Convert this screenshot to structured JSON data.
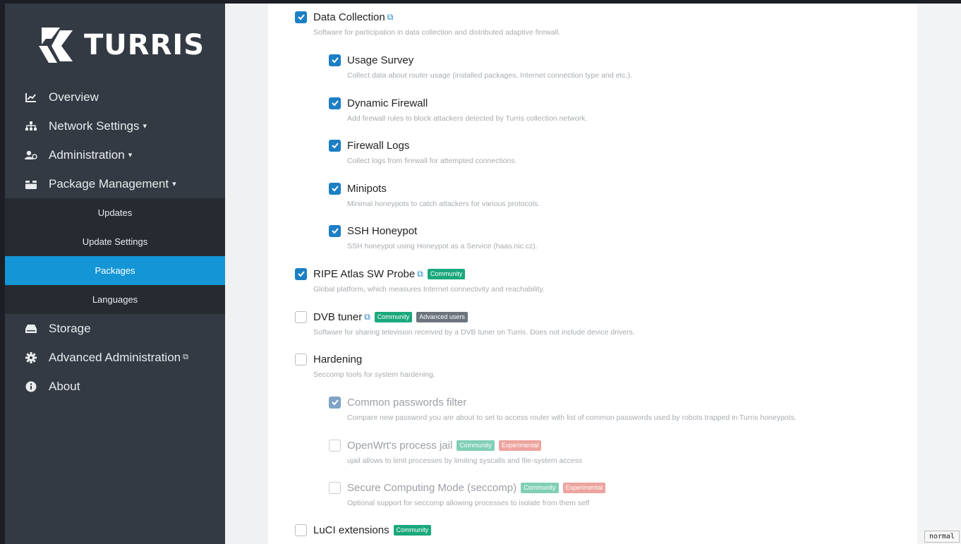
{
  "brand": {
    "name": "TURRIS"
  },
  "sidebar": {
    "items": [
      {
        "label": "Overview",
        "icon": "chart-icon"
      },
      {
        "label": "Network Settings",
        "icon": "network-icon",
        "dropdown": true
      },
      {
        "label": "Administration",
        "icon": "users-icon",
        "dropdown": true
      },
      {
        "label": "Package Management",
        "icon": "package-icon",
        "dropdown": true
      },
      {
        "label": "Storage",
        "icon": "drive-icon"
      },
      {
        "label": "Advanced Administration",
        "icon": "gear-icon",
        "external": true
      },
      {
        "label": "About",
        "icon": "info-icon"
      }
    ],
    "submenu": [
      {
        "label": "Updates"
      },
      {
        "label": "Update Settings"
      },
      {
        "label": "Packages",
        "active": true
      },
      {
        "label": "Languages"
      }
    ]
  },
  "badges": {
    "community": "Community",
    "advanced": "Advanced users",
    "experimental": "Experimental"
  },
  "packages": [
    {
      "title": "Data Collection",
      "checked": true,
      "desc": "Software for participation in data collection and distributed adaptive firewall."
    },
    {
      "title": "Usage Survey",
      "checked": true,
      "desc": "Collect data about router usage (installed packages, Internet connection type and etc.)."
    },
    {
      "title": "Dynamic Firewall",
      "checked": true,
      "desc": "Add firewall rules to block attackers detected by Turris collection network."
    },
    {
      "title": "Firewall Logs",
      "checked": true,
      "desc": "Collect logs from firewall for attempted connections."
    },
    {
      "title": "Minipots",
      "checked": true,
      "desc": "Minimal honeypots to catch attackers for various protocols."
    },
    {
      "title": "SSH Honeypot",
      "checked": true,
      "desc": "SSH honeypot using Honeypot as a Service (haas.nic.cz)."
    },
    {
      "title": "RIPE Atlas SW Probe",
      "checked": true,
      "desc": "Global platform, which measures Internet connectivity and reachability."
    },
    {
      "title": "DVB tuner",
      "checked": false,
      "desc": "Software for sharing television received by a DVB tuner on Turris. Does not include device drivers."
    },
    {
      "title": "Hardening",
      "checked": false,
      "desc": "Seccomp tools for system hardening."
    },
    {
      "title": "Common passwords filter",
      "checked": true,
      "desc": "Compare new password you are about to set to access router with list of common passwords used by robots trapped in Turris honeypots."
    },
    {
      "title": "OpenWrt's process jail",
      "checked": false,
      "desc": "ujail allows to limit processes by limiting syscalls and file-system access"
    },
    {
      "title": "Secure Computing Mode (seccomp)",
      "checked": false,
      "desc": "Optional support for seccomp allowing processes to isolate from them self"
    },
    {
      "title": "LuCI extensions",
      "checked": false,
      "desc": ""
    }
  ],
  "status": {
    "mode": "normal"
  }
}
